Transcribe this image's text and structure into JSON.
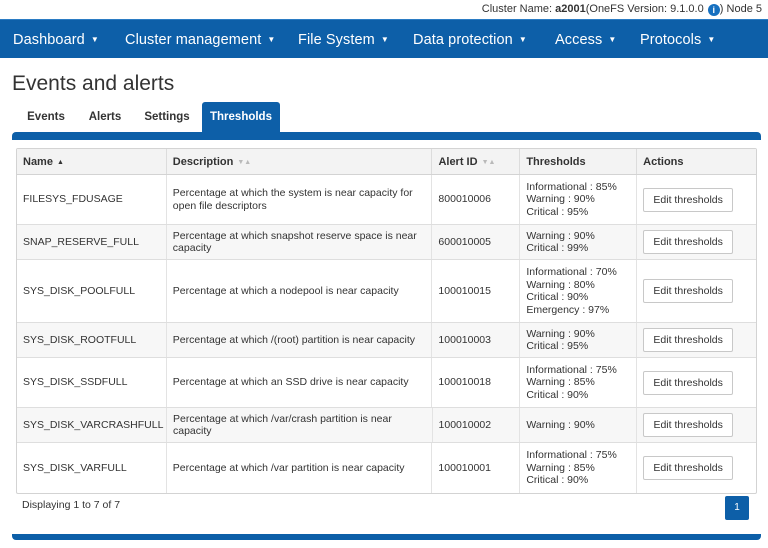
{
  "topinfo": {
    "cluster_label": "Cluster Name: ",
    "cluster_name": "a2001",
    "version": "(OneFS Version: 9.1.0.0",
    "info_glyph": "i",
    "node": ") Node 5"
  },
  "nav": {
    "items": [
      {
        "label": "Dashboard"
      },
      {
        "label": "Cluster management"
      },
      {
        "label": "File System"
      },
      {
        "label": "Data protection"
      },
      {
        "label": "Access"
      },
      {
        "label": "Protocols"
      }
    ],
    "caret": "▼"
  },
  "page": {
    "title": "Events and alerts"
  },
  "tabs": [
    {
      "label": "Events"
    },
    {
      "label": "Alerts"
    },
    {
      "label": "Settings"
    },
    {
      "label": "Thresholds"
    }
  ],
  "active_tab": "Thresholds",
  "table": {
    "columns": [
      {
        "label": "Name",
        "sort": "▲"
      },
      {
        "label": "Description",
        "sort": "▼▲"
      },
      {
        "label": "Alert ID",
        "sort": "▼▲"
      },
      {
        "label": "Thresholds"
      },
      {
        "label": "Actions"
      }
    ],
    "rows": [
      {
        "name": "FILESYS_FDUSAGE",
        "description": "Percentage at which the system is near capacity for open file descriptors",
        "alert_id": "800010006",
        "thresholds": [
          "Informational : 85%",
          "Warning : 90%",
          "Critical : 95%"
        ],
        "action": "Edit thresholds"
      },
      {
        "name": "SNAP_RESERVE_FULL",
        "description": "Percentage at which snapshot reserve space is near capacity",
        "alert_id": "600010005",
        "thresholds": [
          "Warning : 90%",
          "Critical : 99%"
        ],
        "action": "Edit thresholds"
      },
      {
        "name": "SYS_DISK_POOLFULL",
        "description": "Percentage at which a nodepool is near capacity",
        "alert_id": "100010015",
        "thresholds": [
          "Informational : 70%",
          "Warning : 80%",
          "Critical : 90%",
          "Emergency : 97%"
        ],
        "action": "Edit thresholds"
      },
      {
        "name": "SYS_DISK_ROOTFULL",
        "description": "Percentage at which /(root) partition is near capacity",
        "alert_id": "100010003",
        "thresholds": [
          "Warning : 90%",
          "Critical : 95%"
        ],
        "action": "Edit thresholds"
      },
      {
        "name": "SYS_DISK_SSDFULL",
        "description": "Percentage at which an SSD drive is near capacity",
        "alert_id": "100010018",
        "thresholds": [
          "Informational : 75%",
          "Warning : 85%",
          "Critical : 90%"
        ],
        "action": "Edit thresholds"
      },
      {
        "name": "SYS_DISK_VARCRASHFULL",
        "description": "Percentage at which /var/crash partition is near capacity",
        "alert_id": "100010002",
        "thresholds": [
          "Warning : 90%"
        ],
        "action": "Edit thresholds"
      },
      {
        "name": "SYS_DISK_VARFULL",
        "description": "Percentage at which /var partition is near capacity",
        "alert_id": "100010001",
        "thresholds": [
          "Informational : 75%",
          "Warning : 85%",
          "Critical : 90%"
        ],
        "action": "Edit thresholds"
      }
    ]
  },
  "footer": {
    "display_text": "Displaying 1 to 7 of 7",
    "page": "1"
  },
  "colors": {
    "brand": "#0d5fa8"
  }
}
